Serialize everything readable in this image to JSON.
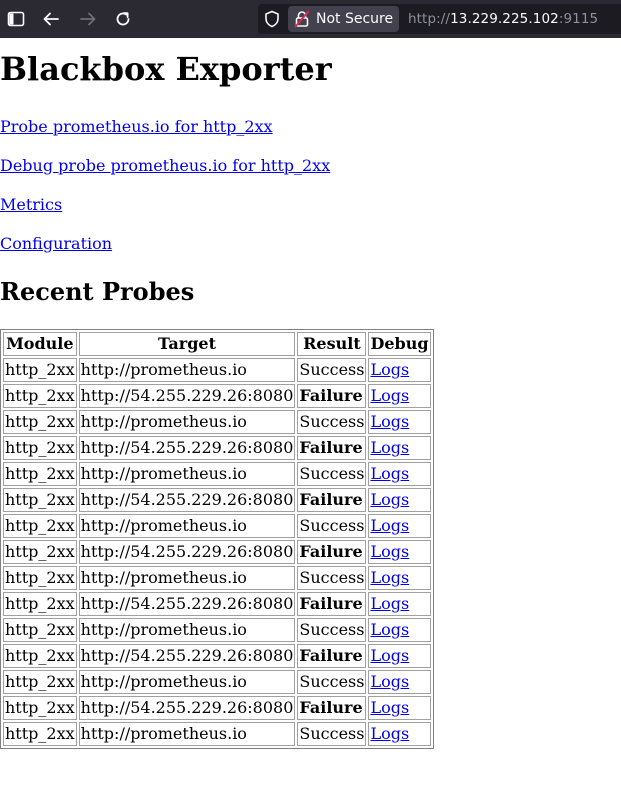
{
  "browser": {
    "security_label": "Not Secure",
    "url_scheme": "http://",
    "url_host": "13.229.225.102",
    "url_port": ":9115"
  },
  "page": {
    "title": "Blackbox Exporter",
    "links": [
      "Probe prometheus.io for http_2xx",
      "Debug probe prometheus.io for http_2xx",
      "Metrics",
      "Configuration"
    ],
    "section_title": "Recent Probes"
  },
  "table": {
    "headers": [
      "Module",
      "Target",
      "Result",
      "Debug"
    ],
    "rows": [
      [
        "http_2xx",
        "http://prometheus.io",
        "Success",
        "Logs"
      ],
      [
        "http_2xx",
        "http://54.255.229.26:8080",
        "Failure",
        "Logs"
      ],
      [
        "http_2xx",
        "http://prometheus.io",
        "Success",
        "Logs"
      ],
      [
        "http_2xx",
        "http://54.255.229.26:8080",
        "Failure",
        "Logs"
      ],
      [
        "http_2xx",
        "http://prometheus.io",
        "Success",
        "Logs"
      ],
      [
        "http_2xx",
        "http://54.255.229.26:8080",
        "Failure",
        "Logs"
      ],
      [
        "http_2xx",
        "http://prometheus.io",
        "Success",
        "Logs"
      ],
      [
        "http_2xx",
        "http://54.255.229.26:8080",
        "Failure",
        "Logs"
      ],
      [
        "http_2xx",
        "http://prometheus.io",
        "Success",
        "Logs"
      ],
      [
        "http_2xx",
        "http://54.255.229.26:8080",
        "Failure",
        "Logs"
      ],
      [
        "http_2xx",
        "http://prometheus.io",
        "Success",
        "Logs"
      ],
      [
        "http_2xx",
        "http://54.255.229.26:8080",
        "Failure",
        "Logs"
      ],
      [
        "http_2xx",
        "http://prometheus.io",
        "Success",
        "Logs"
      ],
      [
        "http_2xx",
        "http://54.255.229.26:8080",
        "Failure",
        "Logs"
      ],
      [
        "http_2xx",
        "http://prometheus.io",
        "Success",
        "Logs"
      ]
    ]
  },
  "icons": {
    "sidebar": "sidebar-toggle-icon",
    "back": "back-arrow-icon",
    "forward": "forward-arrow-icon",
    "reload": "reload-icon",
    "shield": "tracking-shield-icon",
    "lock": "insecure-lock-icon"
  },
  "colors": {
    "chrome_bg": "#2b2a33",
    "urlbar_bg": "#1c1b22",
    "link": "#0000ee",
    "insecure_lock": "#e22850"
  }
}
